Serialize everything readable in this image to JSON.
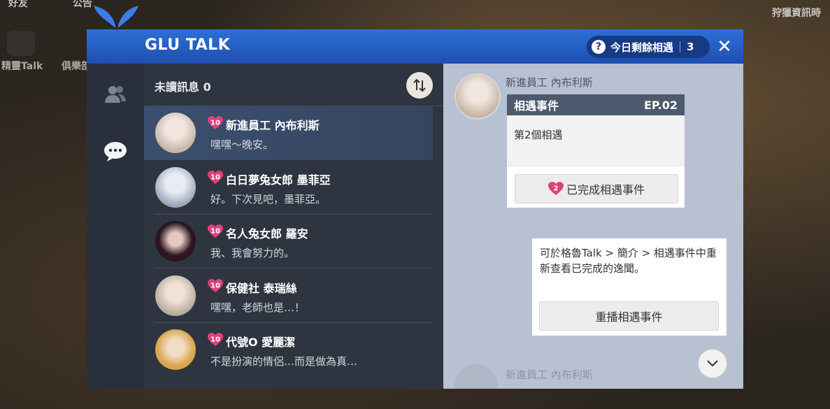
{
  "background": {
    "left_labels": [
      "好友",
      "公告"
    ],
    "desk_items": [
      "精靈Talk",
      "俱樂部"
    ],
    "right_banner": "狩獵資訊時"
  },
  "window": {
    "brand": "GLU TALK",
    "counter_label": "今日剩餘相遇",
    "counter_value": "3",
    "close_icon": "close-icon"
  },
  "list": {
    "unread_label": "未讀訊息 0",
    "rows": [
      {
        "level": "10",
        "name": "新進員工 內布利斯",
        "message": "嘿嘿～晚安。",
        "avatar_color": "#d7c4b6"
      },
      {
        "level": "10",
        "name": "白日夢兔女郎 墨菲亞",
        "message": "好。下次見吧，墨菲亞。",
        "avatar_color": "#bcc6d3"
      },
      {
        "level": "10",
        "name": "名人兔女郎 羅安",
        "message": "我、我會努力的。",
        "avatar_color": "#3d2230"
      },
      {
        "level": "10",
        "name": "保健社 泰瑞絲",
        "message": "嘿嘿，老師也是…！",
        "avatar_color": "#cfc3b5"
      },
      {
        "level": "10",
        "name": "代號O 愛麗潔",
        "message": "不是扮演的情侶…而是做為真…",
        "avatar_color": "#e0b86a"
      }
    ]
  },
  "chat": {
    "sender": "新進員工 內布利斯",
    "card_title": "相遇事件",
    "card_episode": "EP.02",
    "card_text": "第2個相遇",
    "done_badge": "2",
    "done_label": "已完成相遇事件",
    "note_text": "可於格魯Talk > 簡介 > 相遇事件中重新查看已完成的逸聞。",
    "replay_label": "重播相遇事件",
    "faded_sender": "新進員工 內布利斯"
  },
  "colors": {
    "titlebar": "#1d4fae",
    "heart": "#e0407a",
    "active_row": "#3c4f6e"
  }
}
